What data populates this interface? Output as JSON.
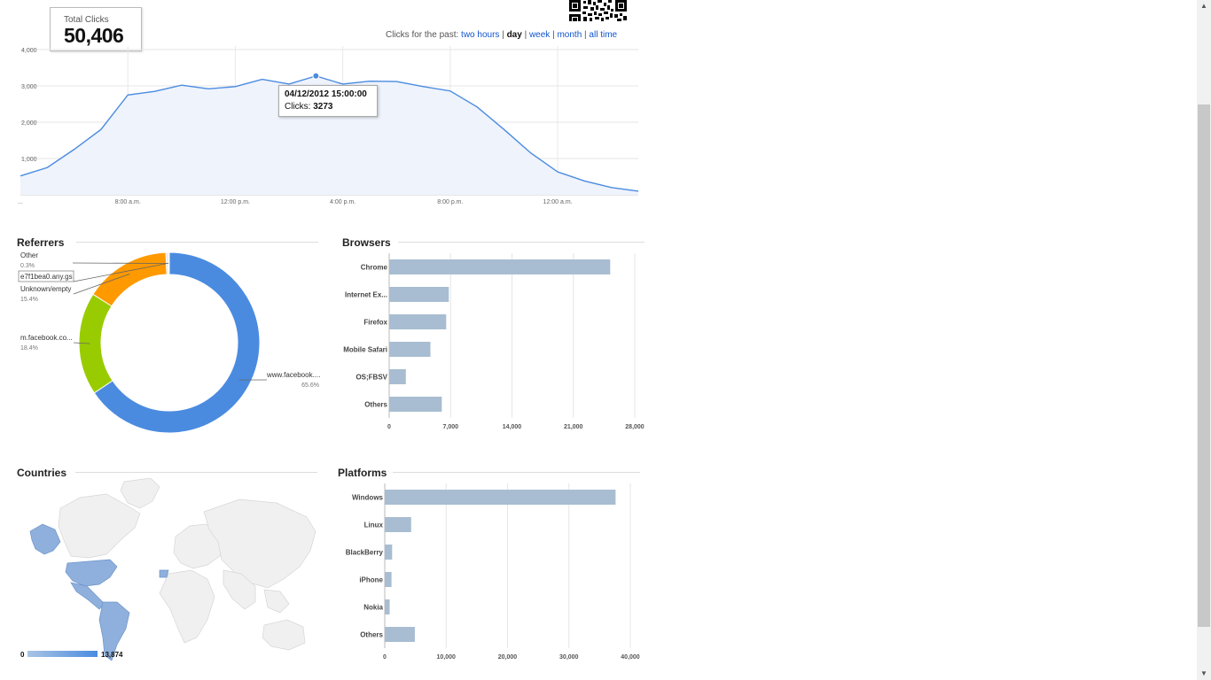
{
  "total": {
    "label": "Total Clicks",
    "value": "50,406"
  },
  "range": {
    "prefix": "Clicks for the past:",
    "options": [
      {
        "label": "two hours",
        "active": false
      },
      {
        "label": "day",
        "active": true
      },
      {
        "label": "week",
        "active": false
      },
      {
        "label": "month",
        "active": false
      },
      {
        "label": "all time",
        "active": false
      }
    ]
  },
  "qr_code": {
    "icon": "qr-code-icon"
  },
  "tooltip": {
    "date": "04/12/2012 15:00:00",
    "clicks_label": "Clicks:",
    "clicks_value": "3273"
  },
  "sections": {
    "referrers": "Referrers",
    "browsers": "Browsers",
    "countries": "Countries",
    "platforms": "Platforms"
  },
  "map": {
    "legend_min": "0",
    "legend_max": "13,874",
    "scale_colors": [
      "#a9c4e4",
      "#4a8be0"
    ]
  },
  "scrollbar": {
    "up_icon": "scroll-up-arrow-icon",
    "down_icon": "scroll-down-arrow-icon"
  },
  "chart_data": [
    {
      "type": "area",
      "name": "clicks-over-time",
      "x_ticks": [
        "...",
        "8:00 a.m.",
        "12:00 p.m.",
        "4:00 p.m.",
        "8:00 p.m.",
        "12:00 a.m."
      ],
      "y_ticks": [
        "1,000",
        "2,000",
        "3,000",
        "4,000"
      ],
      "ylim": [
        0,
        4000
      ],
      "x_hours": [
        0,
        1,
        2,
        3,
        4,
        5,
        6,
        7,
        8,
        9,
        10,
        11,
        12,
        13,
        14,
        15,
        16,
        17,
        18,
        19,
        20,
        21,
        22,
        23
      ],
      "values": [
        520,
        750,
        1250,
        1800,
        2750,
        2850,
        3020,
        2920,
        2980,
        3180,
        3050,
        3273,
        3050,
        3130,
        3120,
        2980,
        2860,
        2420,
        1800,
        1150,
        630,
        380,
        200,
        100
      ],
      "highlight_index": 11,
      "grid": true,
      "colors": {
        "line": "#4a8be0",
        "fill": "#eef3fc"
      }
    },
    {
      "type": "pie",
      "name": "referrers",
      "labels": [
        "www.facebook....",
        "m.facebook.co...",
        "Unknown/empty",
        "e7f1bea0.any.gs",
        "Other"
      ],
      "percents": [
        "65.6%",
        "18.4%",
        "15.4%",
        "",
        "0.3%"
      ],
      "values": [
        65.6,
        18.4,
        15.4,
        0.3,
        0.3
      ],
      "colors": [
        "#4a8be0",
        "#99cc00",
        "#ff9900",
        "#cccccc",
        "#eeeeee"
      ]
    },
    {
      "type": "bar",
      "name": "browsers",
      "categories": [
        "Chrome",
        "Internet Ex...",
        "Firefox",
        "Mobile Safari",
        "OS;FBSV",
        "Others"
      ],
      "values": [
        25200,
        6800,
        6500,
        4700,
        1900,
        6000
      ],
      "x_ticks": [
        "0",
        "7,000",
        "14,000",
        "21,000",
        "28,000"
      ],
      "xlim": [
        0,
        28000
      ],
      "color": "#a8bdd1"
    },
    {
      "type": "bar",
      "name": "platforms",
      "categories": [
        "Windows",
        "Linux",
        "BlackBerry",
        "iPhone",
        "Nokia",
        "Others"
      ],
      "values": [
        37600,
        4300,
        1200,
        1100,
        800,
        4900
      ],
      "x_ticks": [
        "0",
        "10,000",
        "20,000",
        "30,000",
        "40,000"
      ],
      "xlim": [
        0,
        40000
      ],
      "color": "#a8bdd1"
    }
  ]
}
